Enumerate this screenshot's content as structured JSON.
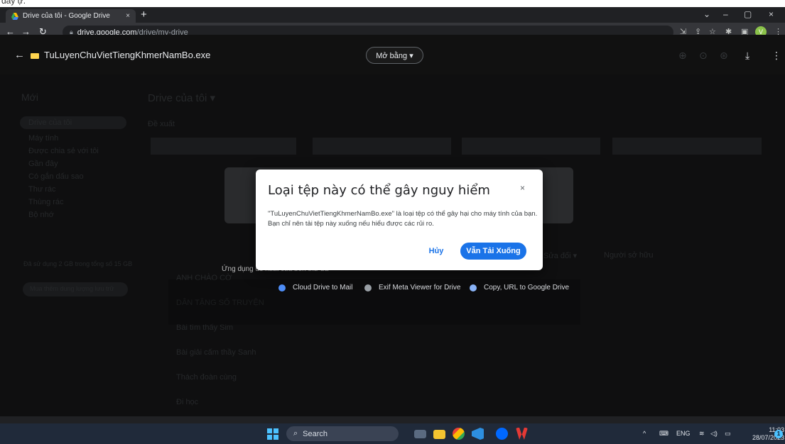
{
  "top_fragment": "đây ự.",
  "browser": {
    "tab_title": "Drive của tôi - Google Drive",
    "tab_close": "×",
    "new_tab": "+",
    "window_controls": [
      "⌄",
      "–",
      "▢",
      "×"
    ],
    "url_host": "drive.google.com",
    "url_path": "/drive/my-drive",
    "profile_initial": "V"
  },
  "viewer": {
    "file_name": "TuLuyenChuVietTiengKhmerNamBo.exe",
    "open_with_label": "Mở bằng ▾"
  },
  "background": {
    "new_button": "Mới",
    "page_title": "Drive của tôi ▾",
    "section_suggested": "Đề xuất",
    "sidebar": [
      "Drive của tôi",
      "Máy tính",
      "Được chia sẻ với tôi",
      "Gần đây",
      "Có gắn dấu sao",
      "Thư rác",
      "Thùng rác",
      "Bộ nhớ"
    ],
    "rows": [
      "ANH CHÀO CỜ",
      "DÂN TẶNG SỐ TRUYỆN",
      "Bài tìm thấy Sim",
      "Bài giải cấm thầy Sanh",
      "Thách đoàn cùng",
      "Đi học"
    ],
    "col_owner": "Người sở hữu",
    "col_sort": "Sửa đổi ▾",
    "storage": "Đã sử dụng 2 GB trong tổng số 15 GB",
    "buy_storage": "Mua thêm dung lượng lưu trữ"
  },
  "apps": {
    "title": "Ứng dụng đề xuất của bên thứ ba",
    "items": [
      {
        "label": "Cloud Drive to Mail",
        "color": "#4f8ef7"
      },
      {
        "label": "Exif Meta Viewer for Drive",
        "color": "#9aa0a6"
      },
      {
        "label": "Copy, URL to Google Drive",
        "color": "#8ab4f8"
      }
    ]
  },
  "dialog": {
    "title": "Loại tệp này có thể gây nguy hiểm",
    "close": "×",
    "message": "\"TuLuyenChuVietTiengKhmerNamBo.exe\" là loại tệp có thể gây hại cho máy tính của bạn. Bạn chỉ nên tải tệp này xuống nếu hiểu được các rủi ro.",
    "cancel_label": "Hủy",
    "download_label": "Vẫn Tải Xuống"
  },
  "taskbar": {
    "search_label": "Search",
    "language": "ENG",
    "time": "11:03",
    "date": "28/07/2023",
    "notification_count": "1"
  },
  "colors": {
    "primary_blue": "#1a73e8",
    "taskbar": "#202a3a",
    "chrome_dark": "#202124"
  }
}
